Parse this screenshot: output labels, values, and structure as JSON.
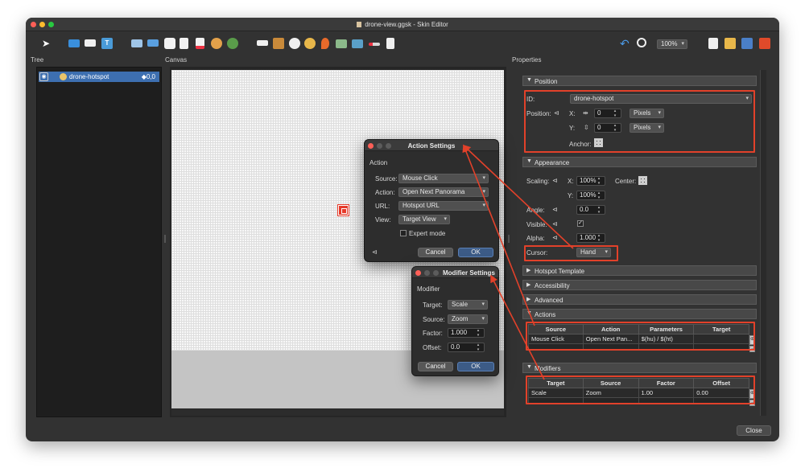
{
  "window": {
    "title": "drone-view.ggsk - Skin Editor"
  },
  "toolbar": {
    "left_tools": [
      "select-tool",
      "folder-icon",
      "rectangle-tool",
      "text-tool",
      "image-tool",
      "tooltip-tool",
      "button-tool",
      "svg-tool",
      "pdf-tool",
      "circle-tool",
      "globe-tool"
    ],
    "mid_tools": [
      "label-tool",
      "grid-tool",
      "compass-tool",
      "cloner-tool",
      "map-pin-tool",
      "photo-tool",
      "video-tool",
      "slider-tool",
      "sound-tool"
    ],
    "zoom": "100%"
  },
  "tree": {
    "label": "Tree",
    "items": [
      {
        "name": "drone-hotspot",
        "value": "◆0,0"
      }
    ]
  },
  "canvas": {
    "label": "Canvas"
  },
  "properties": {
    "label": "Properties",
    "position": {
      "title": "Position",
      "id_label": "ID:",
      "id_value": "drone-hotspot",
      "position_label": "Position:",
      "x_label": "X:",
      "x_value": "0",
      "x_unit": "Pixels",
      "y_label": "Y:",
      "y_value": "0",
      "y_unit": "Pixels",
      "anchor_label": "Anchor:"
    },
    "appearance": {
      "title": "Appearance",
      "scaling_label": "Scaling:",
      "x_label": "X:",
      "x_value": "100%",
      "center_label": "Center:",
      "y_label": "Y:",
      "y_value": "100%",
      "angle_label": "Angle:",
      "angle_value": "0.0",
      "visible_label": "Visible:",
      "visible_check": "✓",
      "alpha_label": "Alpha:",
      "alpha_value": "1.000",
      "cursor_label": "Cursor:",
      "cursor_value": "Hand"
    },
    "collapsed_sections": [
      "Hotspot Template",
      "Accessibility",
      "Advanced"
    ],
    "actions": {
      "title": "Actions",
      "columns": [
        "Source",
        "Action",
        "Parameters",
        "Target"
      ],
      "rows": [
        [
          "Mouse Click",
          "Open Next Pan...",
          "$(hu) / $(ht)",
          ""
        ]
      ]
    },
    "modifiers": {
      "title": "Modifiers",
      "columns": [
        "Target",
        "Source",
        "Factor",
        "Offset"
      ],
      "rows": [
        [
          "Scale",
          "Zoom",
          "1.00",
          "0.00"
        ]
      ]
    }
  },
  "action_dialog": {
    "title": "Action Settings",
    "section": "Action",
    "source_label": "Source:",
    "source_value": "Mouse Click",
    "action_label": "Action:",
    "action_value": "Open Next Panorama",
    "url_label": "URL:",
    "url_value": "Hotspot URL",
    "view_label": "View:",
    "view_value": "Target View",
    "expert_label": "Expert mode",
    "cancel": "Cancel",
    "ok": "OK"
  },
  "modifier_dialog": {
    "title": "Modifier Settings",
    "section": "Modifier",
    "target_label": "Target:",
    "target_value": "Scale",
    "source_label": "Source:",
    "source_value": "Zoom",
    "factor_label": "Factor:",
    "factor_value": "1.000",
    "offset_label": "Offset:",
    "offset_value": "0.0",
    "cancel": "Cancel",
    "ok": "OK"
  },
  "footer": {
    "close": "Close"
  },
  "colors": {
    "highlight": "#e2412a",
    "selection": "#3d6fb0",
    "ok_button": "#3c5b86"
  }
}
